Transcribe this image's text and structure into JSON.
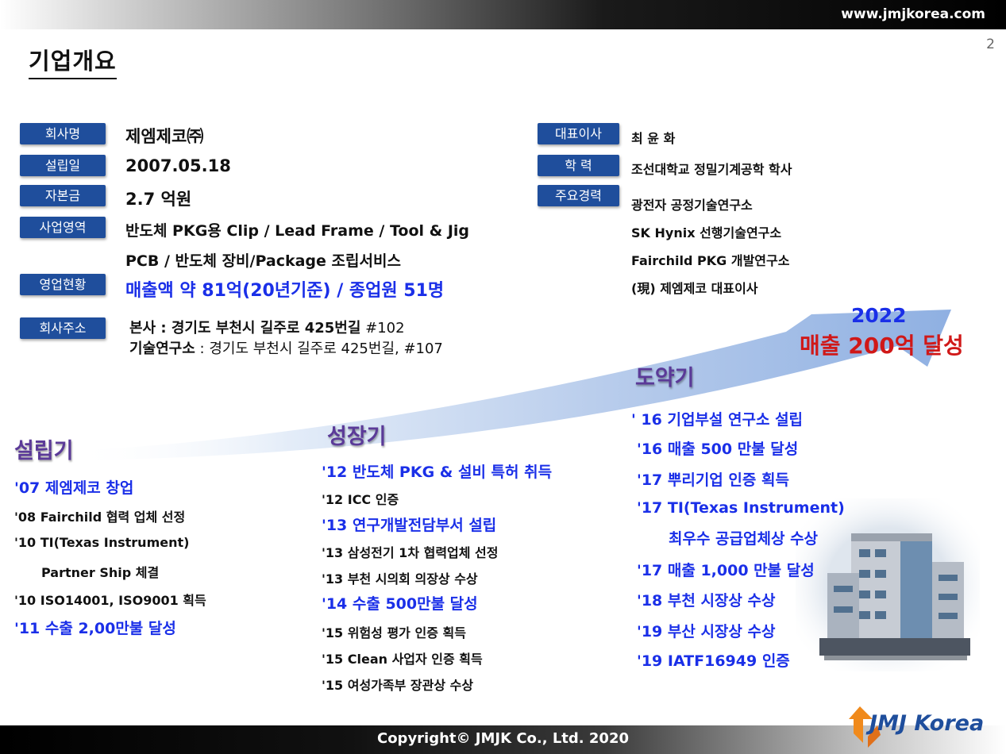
{
  "header": {
    "site": "www.jmjkorea.com",
    "page_number": "2",
    "title": "기업개요"
  },
  "company": [
    {
      "label": "회사명",
      "value": "제엠제코㈜"
    },
    {
      "label": "설립일",
      "value": "2007.05.18"
    },
    {
      "label": "자본금",
      "value": "2.7 억원"
    },
    {
      "label": "사업영역",
      "value": "반도체 PKG용 Clip / Lead Frame / Tool & Jig",
      "value2": "PCB / 반도체 장비/Package 조립서비스"
    },
    {
      "label": "영업현황",
      "value": "매출액 약 81억(20년기준) / 종업원 51명"
    }
  ],
  "address": {
    "label": "회사주소",
    "hq_label": "본사 : 경기도 부천시 길주로 425번길",
    "hq_suffix": " #102",
    "lab_label": "기술연구소",
    "lab_value": " : 경기도 부천시 길주로 425번길, #107"
  },
  "ceo": [
    {
      "label": "대표이사",
      "value": "최 윤 화"
    },
    {
      "label": "학 력",
      "value": "조선대학교 정밀기계공학 학사"
    },
    {
      "label": "주요경력",
      "lines": [
        "광전자 공정기술연구소",
        "SK Hynix 선행기술연구소",
        "Fairchild PKG 개발연구소",
        "(現) 제엠제코 대표이사"
      ]
    }
  ],
  "goal": {
    "year": "2022",
    "text": "매출 200억 달성"
  },
  "phases": [
    {
      "name": "설립기",
      "items": [
        {
          "text": "'07 제엠제코 창업",
          "color": "blue"
        },
        {
          "text": "'08 Fairchild 협력 업체 선정",
          "color": "black"
        },
        {
          "text": "'10 TI(Texas Instrument)",
          "color": "black"
        },
        {
          "text": "Partner Ship 체결",
          "color": "black"
        },
        {
          "text": "'10 ISO14001, ISO9001 획득",
          "color": "black"
        },
        {
          "text": "'11 수출 2,00만불 달성",
          "color": "blue"
        }
      ]
    },
    {
      "name": "성장기",
      "items": [
        {
          "text": "'12 반도체 PKG & 설비 특허 취득",
          "color": "blue"
        },
        {
          "text": "'12 ICC 인증",
          "color": "black"
        },
        {
          "text": "'13 연구개발전담부서 설립",
          "color": "blue"
        },
        {
          "text": "'13 삼성전기 1차 협력업체 선정",
          "color": "black"
        },
        {
          "text": "'13 부천 시의회 의장상 수상",
          "color": "black"
        },
        {
          "text": "'14 수출 500만불 달성",
          "color": "blue"
        },
        {
          "text": "'15 위험성 평가 인증 획득",
          "color": "black"
        },
        {
          "text": "'15 Clean 사업자 인증 획득",
          "color": "black"
        },
        {
          "text": "'15 여성가족부 장관상 수상",
          "color": "black"
        }
      ]
    },
    {
      "name": "도약기",
      "items": [
        {
          "text": "' 16 기업부설 연구소 설립",
          "color": "blue"
        },
        {
          "text": "'16 매출 500 만불 달성",
          "color": "blue"
        },
        {
          "text": "'17 뿌리기업 인증 획득",
          "color": "blue"
        },
        {
          "text": "'17 TI(Texas Instrument)",
          "color": "blue"
        },
        {
          "text": "최우수 공급업체상 수상",
          "color": "blue"
        },
        {
          "text": "'17 매출 1,000 만불 달성",
          "color": "blue"
        },
        {
          "text": "'18 부천 시장상 수상",
          "color": "blue"
        },
        {
          "text": "'19 부산 시장상 수상",
          "color": "blue"
        },
        {
          "text": "'19 IATF16949 인증",
          "color": "blue"
        }
      ]
    }
  ],
  "footer": {
    "copyright": "Copyright© JMJK Co., Ltd. 2020",
    "logo": "JMJ Korea"
  },
  "colors": {
    "badge": "#1f4e9c",
    "highlight_blue": "#1a2fe8",
    "goal_red": "#d01818",
    "phase_purple": "#5b3a98"
  }
}
